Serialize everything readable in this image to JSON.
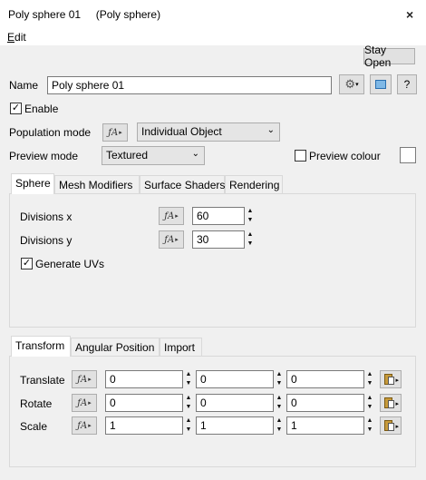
{
  "window": {
    "title": "Poly sphere 01     (Poly sphere)",
    "close_glyph": "×"
  },
  "menu": {
    "edit_accel": "E",
    "edit_rest": "dit"
  },
  "toolbar": {
    "stay_open": "Stay Open"
  },
  "name": {
    "label": "Name",
    "value": "Poly sphere 01"
  },
  "enable": {
    "label": "Enable",
    "checked": true
  },
  "population_mode": {
    "label": "Population mode",
    "value": "Individual Object"
  },
  "preview_mode": {
    "label": "Preview mode",
    "value": "Textured"
  },
  "preview_colour": {
    "label": "Preview colour",
    "checked": false,
    "swatch": "#ffffff"
  },
  "top_tabs": [
    "Sphere",
    "Mesh Modifiers",
    "Surface Shaders",
    "Rendering"
  ],
  "sphere": {
    "divisions_x": {
      "label": "Divisions x",
      "value": "60"
    },
    "divisions_y": {
      "label": "Divisions y",
      "value": "30"
    },
    "generate_uvs": {
      "label": "Generate UVs",
      "checked": true
    }
  },
  "bottom_tabs": [
    "Transform",
    "Angular Position",
    "Import"
  ],
  "transform": {
    "translate": {
      "label": "Translate",
      "values": [
        "0",
        "0",
        "0"
      ]
    },
    "rotate": {
      "label": "Rotate",
      "values": [
        "0",
        "0",
        "0"
      ]
    },
    "scale": {
      "label": "Scale",
      "values": [
        "1",
        "1",
        "1"
      ]
    }
  },
  "glyphs": {
    "fx": "ƒA",
    "tri_right": "▸",
    "spin_up": "▲",
    "spin_down": "▼",
    "chevron": "⌄",
    "help": "?",
    "check": "✓"
  }
}
